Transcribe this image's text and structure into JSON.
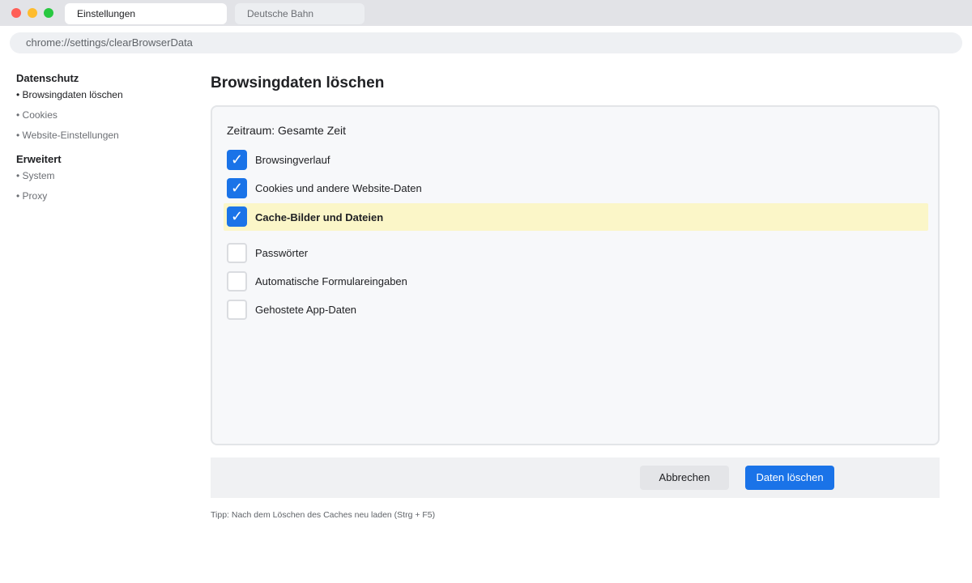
{
  "window": {
    "tabs": [
      {
        "label": "Einstellungen",
        "active": true
      },
      {
        "label": "Deutsche Bahn",
        "active": false
      }
    ],
    "address": "chrome://settings/clearBrowserData"
  },
  "sidebar": {
    "sections": [
      {
        "heading": "Datenschutz",
        "items": [
          "• Browsingdaten löschen",
          "• Cookies",
          "• Website-Einstellungen"
        ]
      },
      {
        "heading": "Erweitert",
        "items": [
          "• System",
          "• Proxy"
        ]
      }
    ],
    "active_item": "• Browsingdaten löschen"
  },
  "main": {
    "title": "Browsingdaten löschen",
    "time_range": "Zeitraum: Gesamte Zeit",
    "options": [
      {
        "label": "Browsingverlauf",
        "checked": true
      },
      {
        "label": "Cookies und andere Website-Daten",
        "checked": true
      },
      {
        "label": "Cache-Bilder und Dateien",
        "checked": true,
        "highlighted": true
      },
      {
        "label": "Passwörter",
        "checked": false
      },
      {
        "label": "Automatische Formulareingaben",
        "checked": false
      },
      {
        "label": "Gehostete App-Daten",
        "checked": false
      }
    ],
    "checkmark": "✓",
    "buttons": {
      "cancel": "Abbrechen",
      "clear": "Daten löschen"
    },
    "tip": "Tipp: Nach dem Löschen des Caches neu laden (Strg + F5)"
  },
  "colors": {
    "accent": "#1a73e8",
    "highlight": "#fbf6c8"
  }
}
